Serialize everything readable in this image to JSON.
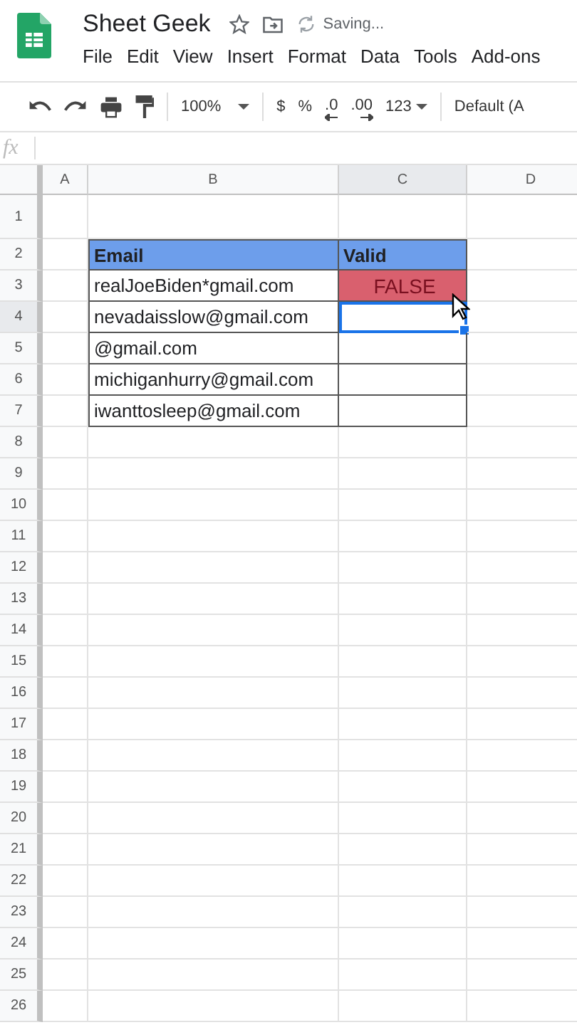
{
  "document": {
    "title": "Sheet Geek",
    "status": "Saving..."
  },
  "menu": [
    "File",
    "Edit",
    "View",
    "Insert",
    "Format",
    "Data",
    "Tools",
    "Add-ons"
  ],
  "toolbar": {
    "zoom": "100%",
    "currency": "$",
    "percent": "%",
    "decrease_decimals": ".0",
    "increase_decimals": ".00",
    "number_format": "123",
    "font": "Default (A"
  },
  "formula_bar": {
    "label": "fx"
  },
  "table": {
    "columns": [
      {
        "label": "A",
        "selected": false
      },
      {
        "label": "B",
        "selected": false
      },
      {
        "label": "C",
        "selected": true
      },
      {
        "label": "D",
        "selected": false
      }
    ],
    "rows": [
      {
        "label": "1",
        "selected": false
      },
      {
        "label": "2",
        "selected": false,
        "kind": "header",
        "email": "Email",
        "valid": {
          "text": "Valid",
          "selected": false
        }
      },
      {
        "label": "3",
        "selected": false,
        "kind": "data",
        "email": "realJoeBiden*gmail.com",
        "valid": {
          "text": "FALSE",
          "color": "#d9606e",
          "selected": false
        }
      },
      {
        "label": "4",
        "selected": true,
        "kind": "data",
        "email": "nevadaisslow@gmail.com",
        "valid": {
          "selected": true
        }
      },
      {
        "label": "5",
        "selected": false,
        "kind": "data",
        "email": "@gmail.com",
        "valid": {
          "selected": false
        }
      },
      {
        "label": "6",
        "selected": false,
        "kind": "data",
        "email": "michiganhurry@gmail.com",
        "valid": {
          "selected": false
        }
      },
      {
        "label": "7",
        "selected": false,
        "kind": "data",
        "email": "iwanttosleep@gmail.com",
        "valid": {
          "selected": false
        }
      },
      {
        "label": "8",
        "selected": false
      },
      {
        "label": "9",
        "selected": false
      },
      {
        "label": "10",
        "selected": false
      },
      {
        "label": "11",
        "selected": false
      },
      {
        "label": "12",
        "selected": false
      },
      {
        "label": "13",
        "selected": false
      },
      {
        "label": "14",
        "selected": false
      },
      {
        "label": "15",
        "selected": false
      },
      {
        "label": "16",
        "selected": false
      },
      {
        "label": "17",
        "selected": false
      },
      {
        "label": "18",
        "selected": false
      },
      {
        "label": "19",
        "selected": false
      },
      {
        "label": "20",
        "selected": false
      },
      {
        "label": "21",
        "selected": false
      },
      {
        "label": "22",
        "selected": false
      },
      {
        "label": "23",
        "selected": false
      },
      {
        "label": "24",
        "selected": false
      },
      {
        "label": "25",
        "selected": false
      },
      {
        "label": "26",
        "selected": false
      }
    ]
  }
}
